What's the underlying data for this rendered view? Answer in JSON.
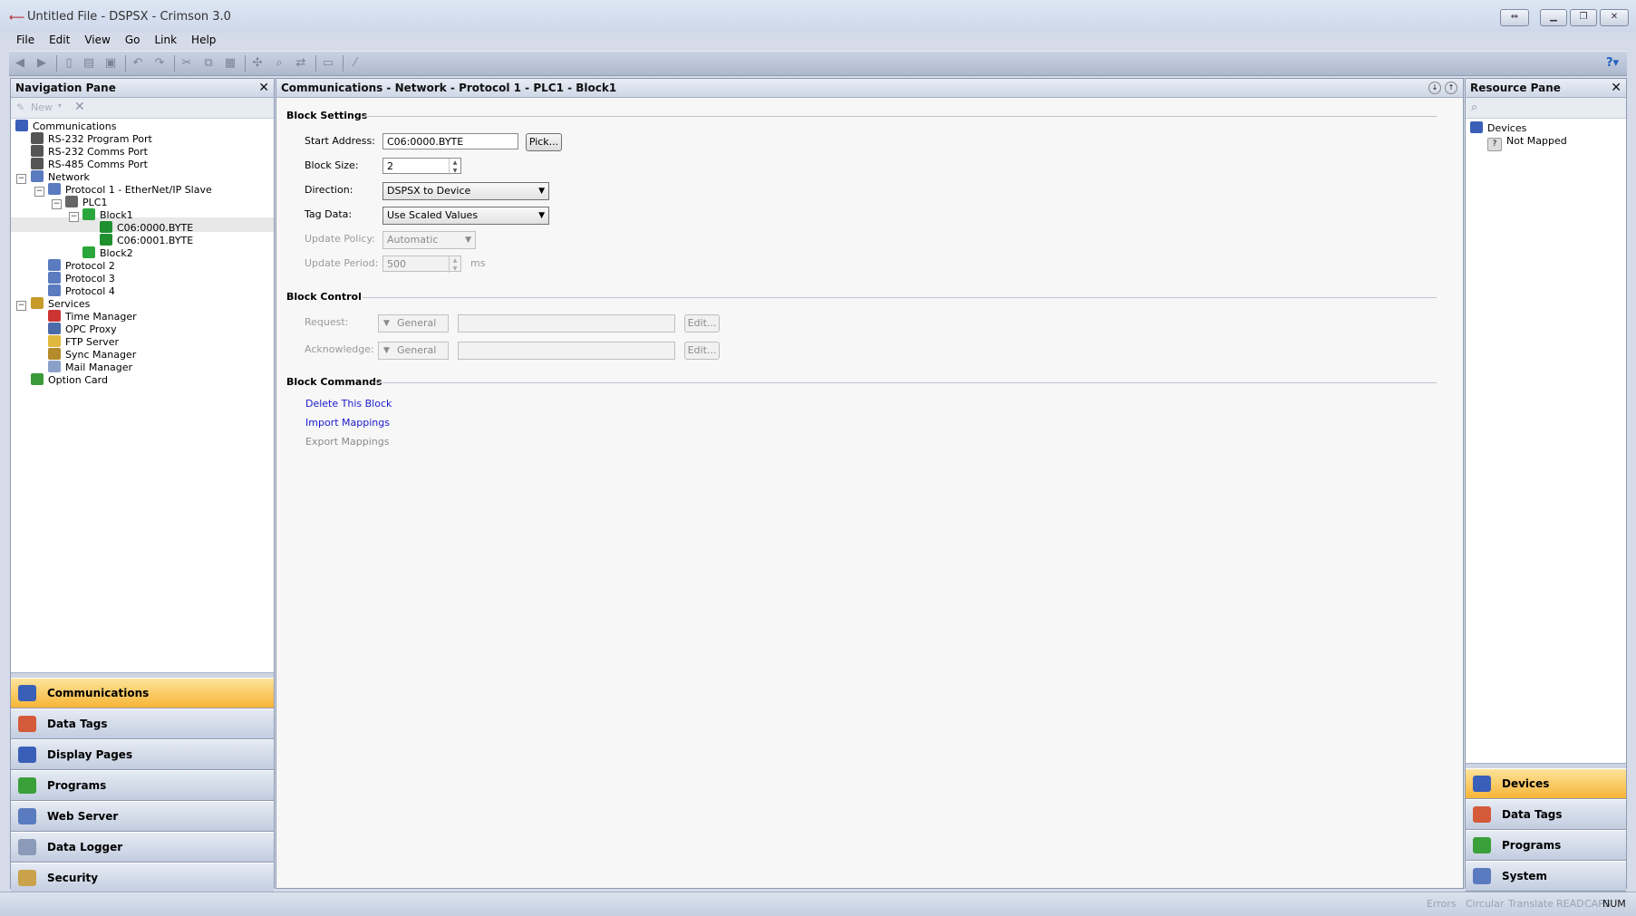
{
  "window": {
    "title": "Untitled File - DSPSX - Crimson 3.0"
  },
  "menu": [
    {
      "label": "File"
    },
    {
      "label": "Edit"
    },
    {
      "label": "View"
    },
    {
      "label": "Go"
    },
    {
      "label": "Link"
    },
    {
      "label": "Help"
    }
  ],
  "nav_pane": {
    "title": "Navigation Pane",
    "toolbar": {
      "new_label": "New"
    },
    "tree": [
      {
        "label": "Communications",
        "icon": "communications-icon"
      },
      {
        "label": "RS-232 Program Port",
        "icon": "serial-port-icon"
      },
      {
        "label": "RS-232 Comms Port",
        "icon": "serial-port-icon"
      },
      {
        "label": "RS-485 Comms Port",
        "icon": "serial-port-icon"
      },
      {
        "label": "Network",
        "icon": "network-icon"
      },
      {
        "label": "Protocol 1 - EtherNet/IP Slave",
        "icon": "protocol-icon"
      },
      {
        "label": "PLC1",
        "icon": "plc-icon"
      },
      {
        "label": "Block1",
        "icon": "block-icon"
      },
      {
        "label": "C06:0000.BYTE",
        "icon": "mapping-icon"
      },
      {
        "label": "C06:0001.BYTE",
        "icon": "mapping-icon"
      },
      {
        "label": "Block2",
        "icon": "block-icon"
      },
      {
        "label": "Protocol 2",
        "icon": "protocol-icon"
      },
      {
        "label": "Protocol 3",
        "icon": "protocol-icon"
      },
      {
        "label": "Protocol 4",
        "icon": "protocol-icon"
      },
      {
        "label": "Services",
        "icon": "services-icon"
      },
      {
        "label": "Time Manager",
        "icon": "clock-icon"
      },
      {
        "label": "OPC Proxy",
        "icon": "opc-icon"
      },
      {
        "label": "FTP Server",
        "icon": "ftp-icon"
      },
      {
        "label": "Sync Manager",
        "icon": "sync-icon"
      },
      {
        "label": "Mail Manager",
        "icon": "mail-icon"
      },
      {
        "label": "Option Card",
        "icon": "card-icon"
      }
    ],
    "selected": "Block1",
    "buttons": [
      {
        "label": "Communications",
        "active": true
      },
      {
        "label": "Data Tags",
        "active": false
      },
      {
        "label": "Display Pages",
        "active": false
      },
      {
        "label": "Programs",
        "active": false
      },
      {
        "label": "Web Server",
        "active": false
      },
      {
        "label": "Data Logger",
        "active": false
      },
      {
        "label": "Security",
        "active": false
      }
    ]
  },
  "main": {
    "breadcrumb": "Communications - Network - Protocol 1 - PLC1 - Block1",
    "block_settings": {
      "title": "Block Settings",
      "start_address_label": "Start Address:",
      "start_address_value": "C06:0000.BYTE",
      "pick_label": "Pick...",
      "block_size_label": "Block Size:",
      "block_size_value": "2",
      "direction_label": "Direction:",
      "direction_value": "DSPSX to Device",
      "tag_data_label": "Tag Data:",
      "tag_data_value": "Use Scaled Values",
      "update_policy_label": "Update Policy:",
      "update_policy_value": "Automatic",
      "update_period_label": "Update Period:",
      "update_period_value": "500",
      "update_period_unit": "ms"
    },
    "block_control": {
      "title": "Block Control",
      "request_label": "Request:",
      "request_type": "General",
      "request_edit": "Edit...",
      "acknowledge_label": "Acknowledge:",
      "acknowledge_type": "General",
      "acknowledge_edit": "Edit..."
    },
    "block_commands": {
      "title": "Block Commands",
      "delete": "Delete This Block",
      "import": "Import Mappings",
      "export": "Export Mappings"
    }
  },
  "resource_pane": {
    "title": "Resource Pane",
    "tree": [
      {
        "label": "Devices"
      },
      {
        "label": "Not Mapped"
      }
    ],
    "buttons": [
      {
        "label": "Devices",
        "active": true
      },
      {
        "label": "Data Tags",
        "active": false
      },
      {
        "label": "Programs",
        "active": false
      },
      {
        "label": "System",
        "active": false
      }
    ]
  },
  "status": {
    "items": [
      "Errors",
      "Circular",
      "Translate",
      "READ",
      "CAPS",
      "NUM"
    ],
    "active": "NUM"
  },
  "colors": {
    "active_button": "#f7b536",
    "link": "#1a1acc"
  }
}
